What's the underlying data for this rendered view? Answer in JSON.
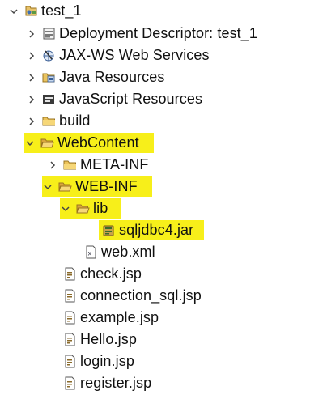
{
  "tree": {
    "project": {
      "label": "test_1",
      "icon": "java-ee-project-icon"
    },
    "deployment_descriptor": {
      "label": "Deployment Descriptor: test_1",
      "icon": "deployment-descriptor-icon"
    },
    "jaxws": {
      "label": "JAX-WS Web Services",
      "icon": "web-services-icon"
    },
    "java_resources": {
      "label": "Java Resources",
      "icon": "java-resources-icon"
    },
    "javascript_resources": {
      "label": "JavaScript Resources",
      "icon": "javascript-resources-icon"
    },
    "build": {
      "label": "build",
      "icon": "folder-icon"
    },
    "webcontent": {
      "label": "WebContent",
      "icon": "folder-open-icon",
      "highlighted": true
    },
    "meta_inf": {
      "label": "META-INF",
      "icon": "folder-icon"
    },
    "web_inf": {
      "label": "WEB-INF",
      "icon": "folder-open-icon",
      "highlighted": true
    },
    "lib": {
      "label": "lib",
      "icon": "folder-open-icon",
      "highlighted": true
    },
    "jar": {
      "label": "sqljdbc4.jar",
      "icon": "jar-icon",
      "highlighted": true
    },
    "web_xml": {
      "label": "web.xml",
      "icon": "xml-file-icon"
    },
    "files": [
      {
        "label": "check.jsp",
        "icon": "jsp-file-icon"
      },
      {
        "label": "connection_sql.jsp",
        "icon": "jsp-file-icon"
      },
      {
        "label": "example.jsp",
        "icon": "jsp-file-icon"
      },
      {
        "label": "Hello.jsp",
        "icon": "jsp-file-icon"
      },
      {
        "label": "login.jsp",
        "icon": "jsp-file-icon"
      },
      {
        "label": "register.jsp",
        "icon": "jsp-file-icon"
      }
    ],
    "highlight_color": "#f7ef1a"
  }
}
